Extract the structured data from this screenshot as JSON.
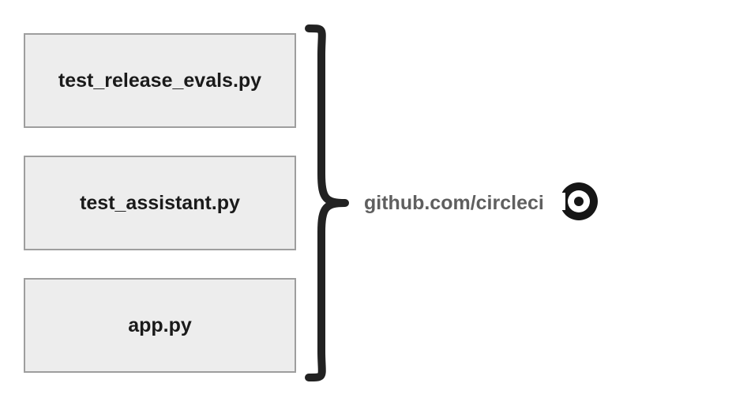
{
  "files": [
    {
      "label": "test_release_evals.py"
    },
    {
      "label": "test_assistant.py"
    },
    {
      "label": "app.py"
    }
  ],
  "right": {
    "label": "github.com/circleci",
    "icon_name": "circleci-icon"
  },
  "colors": {
    "box_bg": "#ededed",
    "box_border": "#9e9e9e",
    "brace": "#222222",
    "right_text": "#5f5f5f",
    "icon": "#161616"
  }
}
